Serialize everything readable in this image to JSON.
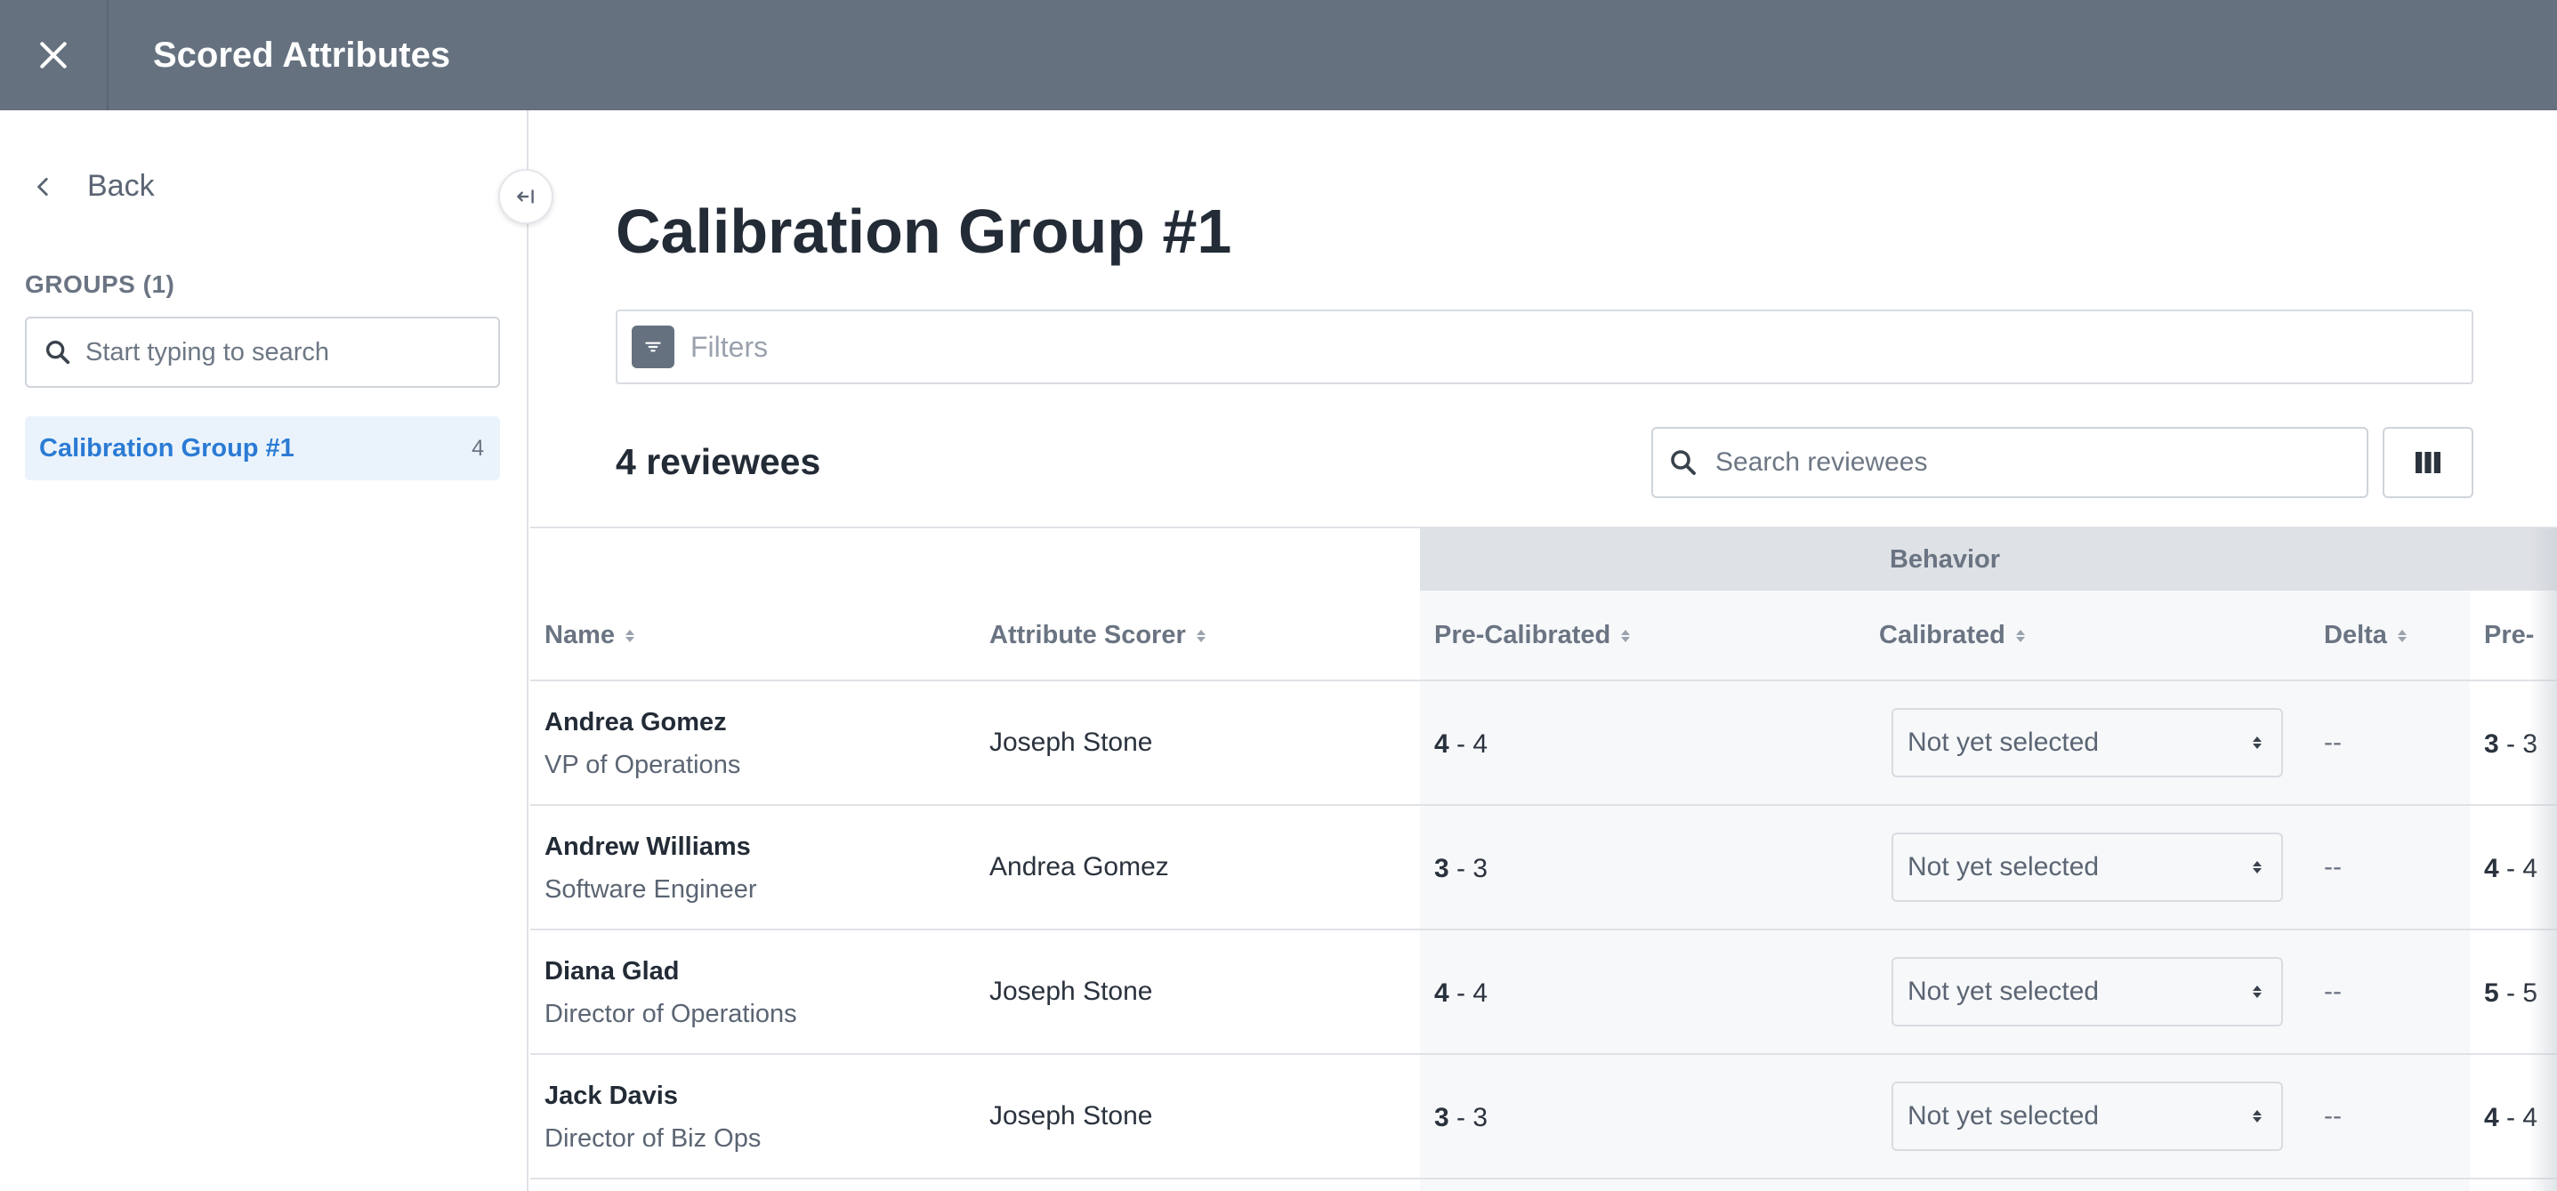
{
  "header": {
    "title": "Scored Attributes",
    "close_icon": "close-icon"
  },
  "sidebar": {
    "back_label": "Back",
    "groups_label": "GROUPS (1)",
    "search_placeholder": "Start typing to search",
    "groups": [
      {
        "name": "Calibration Group #1",
        "count": "4"
      }
    ]
  },
  "main": {
    "title": "Calibration Group #1",
    "filters_placeholder": "Filters",
    "reviewee_count": "4 reviewees",
    "search_placeholder": "Search reviewees"
  },
  "table": {
    "group_header": "Behavior",
    "columns": {
      "name": "Name",
      "scorer": "Attribute Scorer",
      "pre_calibrated": "Pre-Calibrated",
      "calibrated": "Calibrated",
      "delta": "Delta",
      "next_pre": "Pre-"
    },
    "rows": [
      {
        "name": "Andrea Gomez",
        "role": "VP of Operations",
        "scorer": "Joseph Stone",
        "pre_a": "4",
        "pre_b": " - 4",
        "calibrated": "Not yet selected",
        "delta": "--",
        "next_a": "3",
        "next_b": " - 3"
      },
      {
        "name": "Andrew Williams",
        "role": "Software Engineer",
        "scorer": "Andrea Gomez",
        "pre_a": "3",
        "pre_b": " - 3",
        "calibrated": "Not yet selected",
        "delta": "--",
        "next_a": "4",
        "next_b": " - 4"
      },
      {
        "name": "Diana Glad",
        "role": "Director of Operations",
        "scorer": "Joseph Stone",
        "pre_a": "4",
        "pre_b": " - 4",
        "calibrated": "Not yet selected",
        "delta": "--",
        "next_a": "5",
        "next_b": " - 5"
      },
      {
        "name": "Jack Davis",
        "role": "Director of Biz Ops",
        "scorer": "Joseph Stone",
        "pre_a": "3",
        "pre_b": " - 3",
        "calibrated": "Not yet selected",
        "delta": "--",
        "next_a": "4",
        "next_b": " - 4"
      }
    ]
  },
  "colors": {
    "header_bg": "#65717f",
    "accent": "#2b7bd4",
    "group_header_bg": "#dee1e5"
  }
}
